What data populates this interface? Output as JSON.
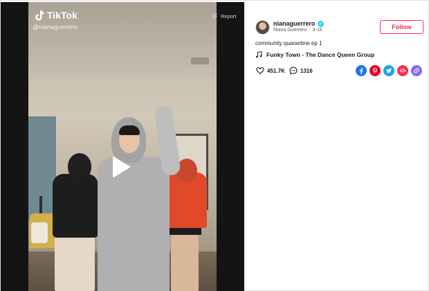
{
  "video": {
    "brand": "TikTok",
    "handle": "@nianaguerrero",
    "report_label": "Report"
  },
  "author": {
    "username": "nianaguerrero",
    "display_name": "Niana Guerrero",
    "separator": "·",
    "date": "3-16"
  },
  "follow_label": "Follow",
  "caption": "community quarantine ep 1",
  "music": "Funky Town - The Dance Queen Group",
  "stats": {
    "likes": "451.7K",
    "comments": "1316"
  },
  "share_buttons": [
    {
      "name": "facebook",
      "color": "#1877f2"
    },
    {
      "name": "pinterest",
      "color": "#e60023"
    },
    {
      "name": "twitter",
      "color": "#1da1f2"
    },
    {
      "name": "embed",
      "color": "#fe2c55"
    },
    {
      "name": "copy-link",
      "color": "#7c6cf6"
    }
  ],
  "colors": {
    "accent": "#fe2c55",
    "verified": "#20d5ec"
  }
}
